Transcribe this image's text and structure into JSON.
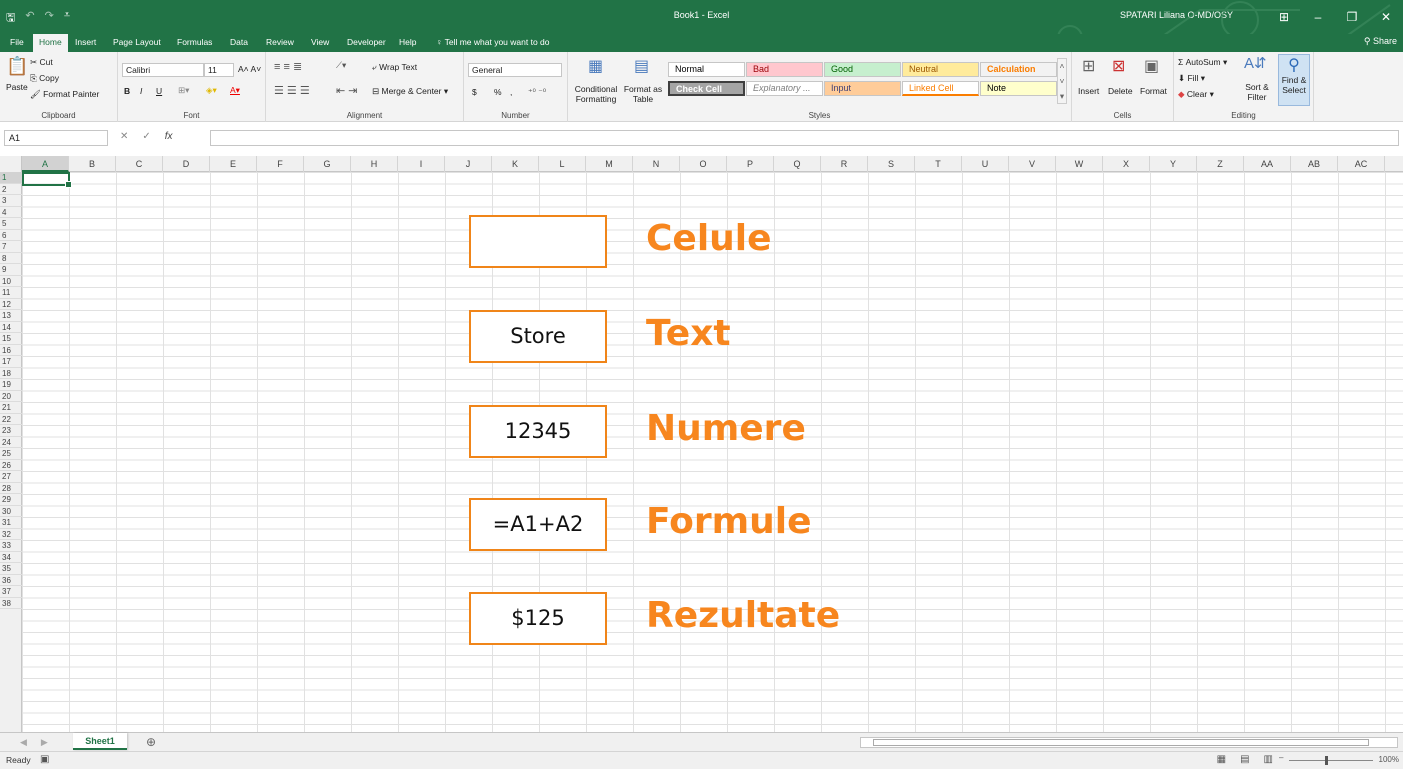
{
  "titlebar": {
    "doc_title": "Book1 - Excel",
    "user": "SPATARI Liliana O-MD/OSY",
    "qat": [
      "save-icon",
      "undo-icon",
      "redo-icon",
      "customize-icon"
    ]
  },
  "menu": {
    "tabs": [
      "File",
      "Home",
      "Insert",
      "Page Layout",
      "Formulas",
      "Data",
      "Review",
      "View",
      "Developer",
      "Help"
    ],
    "tell_me": "Tell me what you want to do",
    "share": "Share"
  },
  "ribbon": {
    "clipboard": {
      "paste": "Paste",
      "cut": "Cut",
      "copy": "Copy",
      "format_painter": "Format Painter",
      "label": "Clipboard"
    },
    "font": {
      "name": "Calibri",
      "size": "11",
      "bold": "B",
      "italic": "I",
      "underline": "U",
      "label": "Font"
    },
    "alignment": {
      "wrap_text": "Wrap Text",
      "merge_center": "Merge & Center",
      "label": "Alignment"
    },
    "number": {
      "format": "General",
      "currency": "$",
      "percent": "%",
      "comma": ",",
      "label": "Number"
    },
    "styles": {
      "conditional": "Conditional Formatting",
      "format_as_table": "Format as Table",
      "cells": [
        {
          "label": "Normal",
          "bg": "#ffffff",
          "fg": "#000000"
        },
        {
          "label": "Bad",
          "bg": "#ffc7ce",
          "fg": "#9c0006"
        },
        {
          "label": "Good",
          "bg": "#c6efce",
          "fg": "#006100"
        },
        {
          "label": "Neutral",
          "bg": "#ffeb9c",
          "fg": "#9c5700"
        },
        {
          "label": "Calculation",
          "bg": "#f2f2f2",
          "fg": "#fa7d00"
        },
        {
          "label": "Check Cell",
          "bg": "#a5a5a5",
          "fg": "#ffffff"
        },
        {
          "label": "Explanatory ...",
          "bg": "#ffffff",
          "fg": "#7f7f7f"
        },
        {
          "label": "Input",
          "bg": "#ffcc99",
          "fg": "#3f3f76"
        },
        {
          "label": "Linked Cell",
          "bg": "#ffffff",
          "fg": "#fa7d00"
        },
        {
          "label": "Note",
          "bg": "#ffffcc",
          "fg": "#000000"
        }
      ],
      "label": "Styles"
    },
    "cells": {
      "insert": "Insert",
      "delete": "Delete",
      "format": "Format",
      "label": "Cells"
    },
    "editing": {
      "autosum": "AutoSum",
      "fill": "Fill",
      "clear": "Clear",
      "sort_filter": "Sort & Filter",
      "find_select": "Find & Select",
      "label": "Editing"
    }
  },
  "formula_bar": {
    "name_box": "A1",
    "fx": "fx",
    "value": ""
  },
  "grid": {
    "columns": [
      "A",
      "B",
      "C",
      "D",
      "E",
      "F",
      "G",
      "H",
      "I",
      "J",
      "K",
      "L",
      "M",
      "N",
      "O",
      "P",
      "Q",
      "R",
      "S",
      "T",
      "U",
      "V",
      "W",
      "X",
      "Y",
      "Z",
      "AA",
      "AB",
      "AC"
    ],
    "rows": [
      "1",
      "2",
      "3",
      "4",
      "5",
      "6",
      "7",
      "8",
      "9",
      "10",
      "11",
      "12",
      "13",
      "14",
      "15",
      "16",
      "17",
      "18",
      "19",
      "20",
      "21",
      "22",
      "23",
      "24",
      "25",
      "26",
      "27",
      "28",
      "29",
      "30",
      "31",
      "32",
      "33",
      "34",
      "35",
      "36",
      "37",
      "38"
    ],
    "active_cell": "A1"
  },
  "overlay": {
    "items": [
      {
        "box": "",
        "label": "Celule"
      },
      {
        "box": "Store",
        "label": "Text"
      },
      {
        "box": "12345",
        "label": "Numere"
      },
      {
        "box": "=A1+A2",
        "label": "Formule"
      },
      {
        "box": "$125",
        "label": "Rezultate"
      }
    ],
    "accent": "#f7861e"
  },
  "sheets": {
    "tabs": [
      "Sheet1"
    ],
    "active": "Sheet1"
  },
  "status": {
    "text": "Ready",
    "zoom": "100%"
  },
  "colors": {
    "excel_green": "#217346"
  }
}
